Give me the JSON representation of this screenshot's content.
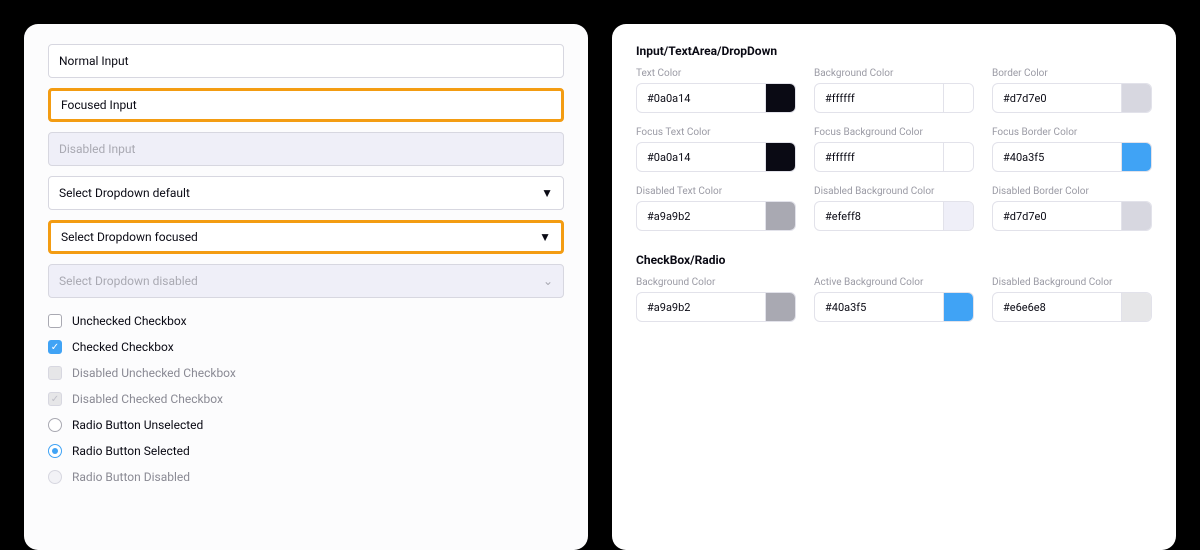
{
  "preview": {
    "normal_input": "Normal Input",
    "focused_input": "Focused Input",
    "disabled_input": "Disabled Input",
    "select_default": "Select Dropdown default",
    "select_focused": "Select Dropdown focused",
    "select_disabled": "Select Dropdown disabled",
    "checkbox_unchecked": "Unchecked Checkbox",
    "checkbox_checked": "Checked Checkbox",
    "checkbox_dis_unchecked": "Disabled Unchecked Checkbox",
    "checkbox_dis_checked": "Disabled Checked Checkbox",
    "radio_unselected": "Radio Button Unselected",
    "radio_selected": "Radio Button Selected",
    "radio_disabled": "Radio Button Disabled"
  },
  "config": {
    "section_input": "Input/TextArea/DropDown",
    "section_checkbox": "CheckBox/Radio",
    "input": {
      "text_color": {
        "label": "Text Color",
        "hex": "#0a0a14",
        "swatch": "#0a0a14"
      },
      "bg_color": {
        "label": "Background Color",
        "hex": "#ffffff",
        "swatch": "#ffffff"
      },
      "border_color": {
        "label": "Border Color",
        "hex": "#d7d7e0",
        "swatch": "#d7d7e0"
      },
      "focus_text_color": {
        "label": "Focus Text Color",
        "hex": "#0a0a14",
        "swatch": "#0a0a14"
      },
      "focus_bg_color": {
        "label": "Focus Background Color",
        "hex": "#ffffff",
        "swatch": "#ffffff"
      },
      "focus_border_color": {
        "label": "Focus Border Color",
        "hex": "#40a3f5",
        "swatch": "#40a3f5"
      },
      "dis_text_color": {
        "label": "Disabled Text Color",
        "hex": "#a9a9b2",
        "swatch": "#a9a9b2"
      },
      "dis_bg_color": {
        "label": "Disabled Background Color",
        "hex": "#efeff8",
        "swatch": "#efeff8"
      },
      "dis_border_color": {
        "label": "Disabled Border Color",
        "hex": "#d7d7e0",
        "swatch": "#d7d7e0"
      }
    },
    "checkbox": {
      "bg_color": {
        "label": "Background Color",
        "hex": "#a9a9b2",
        "swatch": "#a9a9b2"
      },
      "active_bg_color": {
        "label": "Active Background Color",
        "hex": "#40a3f5",
        "swatch": "#40a3f5"
      },
      "dis_bg_color": {
        "label": "Disabled Background Color",
        "hex": "#e6e6e8",
        "swatch": "#e6e6e8"
      }
    }
  }
}
